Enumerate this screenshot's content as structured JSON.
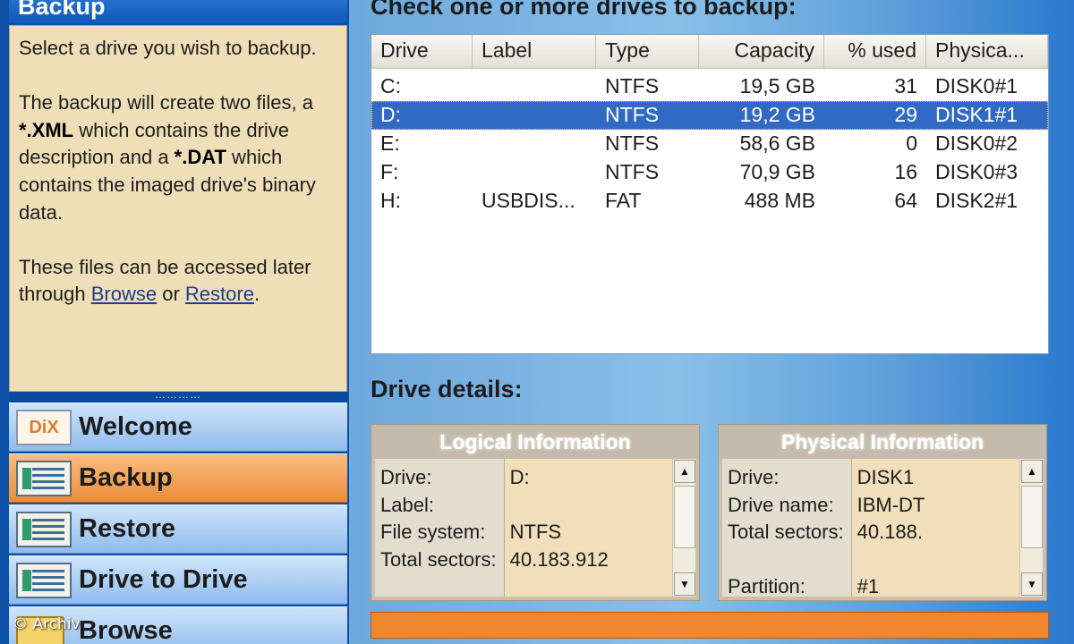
{
  "help": {
    "title": "Backup",
    "p1": "Select a drive you wish to backup.",
    "p2_a": "The backup will create two files, a ",
    "p2_xml": "*.XML",
    "p2_b": " which contains the drive description and a ",
    "p2_dat": "*.DAT",
    "p2_c": " which contains the imaged drive's binary data.",
    "p3_a": "These files can be accessed later through ",
    "p3_browse": "Browse",
    "p3_or": " or ",
    "p3_restore": "Restore",
    "p3_end": ".",
    "splitter": "…………"
  },
  "nav": {
    "welcome": "Welcome",
    "welcome_badge": "DiX",
    "backup": "Backup",
    "restore": "Restore",
    "drive_to_drive": "Drive to Drive",
    "browse": "Browse"
  },
  "copyright": "© Archiv",
  "drives": {
    "title": "Check one or more drives to backup:",
    "columns": [
      "Drive",
      "Label",
      "Type",
      "Capacity",
      "% used",
      "Physica..."
    ],
    "rows": [
      {
        "drive": "C:",
        "label": "",
        "type": "NTFS",
        "capacity": "19,5 GB",
        "used": "31",
        "physical": "DISK0#1"
      },
      {
        "drive": "D:",
        "label": "",
        "type": "NTFS",
        "capacity": "19,2 GB",
        "used": "29",
        "physical": "DISK1#1"
      },
      {
        "drive": "E:",
        "label": "",
        "type": "NTFS",
        "capacity": "58,6 GB",
        "used": "0",
        "physical": "DISK0#2"
      },
      {
        "drive": "F:",
        "label": "",
        "type": "NTFS",
        "capacity": "70,9 GB",
        "used": "16",
        "physical": "DISK0#3"
      },
      {
        "drive": "H:",
        "label": "USBDIS...",
        "type": "FAT",
        "capacity": "488 MB",
        "used": "64",
        "physical": "DISK2#1"
      }
    ],
    "selected_row": "D:"
  },
  "details": {
    "title": "Drive details:",
    "logical": {
      "heading": "Logical Information",
      "keys": [
        "Drive:",
        "Label:",
        "File system:",
        "Total sectors:"
      ],
      "values": [
        "D:",
        "",
        "NTFS",
        "40.183.912"
      ]
    },
    "physical": {
      "heading": "Physical Information",
      "keys": [
        "Drive:",
        "Drive name:",
        "Total sectors:",
        "",
        "Partition:"
      ],
      "values": [
        "DISK1",
        "IBM-DT",
        "40.188.",
        "",
        "#1"
      ]
    }
  },
  "colors": {
    "selection": "#316ac5",
    "active_nav": "#ec8d38",
    "help_bg": "#efdfb8",
    "progress": "#f0862e"
  }
}
